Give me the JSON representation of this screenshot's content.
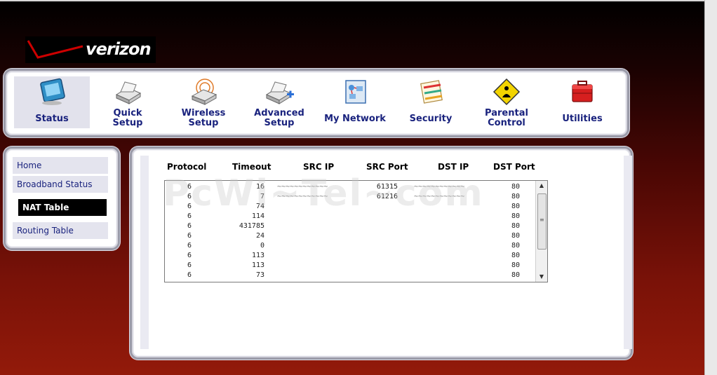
{
  "brand": {
    "logo_text": "verizon",
    "accent_color": "#cc0000"
  },
  "nav": {
    "items": [
      {
        "label_1": "Status",
        "label_2": "",
        "icon": "status-icon",
        "active": true
      },
      {
        "label_1": "Quick",
        "label_2": "Setup",
        "icon": "quick-setup-icon"
      },
      {
        "label_1": "Wireless",
        "label_2": "Setup",
        "icon": "wireless-setup-icon"
      },
      {
        "label_1": "Advanced",
        "label_2": "Setup",
        "icon": "advanced-setup-icon"
      },
      {
        "label_1": "My Network",
        "label_2": "",
        "icon": "my-network-icon"
      },
      {
        "label_1": "Security",
        "label_2": "",
        "icon": "security-icon"
      },
      {
        "label_1": "Parental",
        "label_2": "Control",
        "icon": "parental-control-icon"
      },
      {
        "label_1": "Utilities",
        "label_2": "",
        "icon": "utilities-icon"
      }
    ]
  },
  "sidebar": {
    "items": [
      {
        "label": "Home"
      },
      {
        "label": "Broadband Status"
      },
      {
        "label": "NAT Table",
        "active": true
      },
      {
        "label": "Routing Table"
      }
    ]
  },
  "nat_table": {
    "columns": [
      "Protocol",
      "Timeout",
      "SRC IP",
      "SRC Port",
      "DST IP",
      "DST Port"
    ],
    "rows": [
      {
        "protocol": "6",
        "timeout": "16",
        "src_ip": "~~~~~~~~~~~~",
        "src_port": "61315",
        "dst_ip": "~~~~~~~~~~~~",
        "dst_port": "80"
      },
      {
        "protocol": "6",
        "timeout": "7",
        "src_ip": "~~~~~~~~~~~~",
        "src_port": "61216",
        "dst_ip": "~~~~~~~~~~~~",
        "dst_port": "80"
      },
      {
        "protocol": "6",
        "timeout": "74",
        "src_ip": "",
        "src_port": "",
        "dst_ip": "",
        "dst_port": "80"
      },
      {
        "protocol": "6",
        "timeout": "114",
        "src_ip": "",
        "src_port": "",
        "dst_ip": "",
        "dst_port": "80"
      },
      {
        "protocol": "6",
        "timeout": "431785",
        "src_ip": "",
        "src_port": "",
        "dst_ip": "",
        "dst_port": "80"
      },
      {
        "protocol": "6",
        "timeout": "24",
        "src_ip": "",
        "src_port": "",
        "dst_ip": "",
        "dst_port": "80"
      },
      {
        "protocol": "6",
        "timeout": "0",
        "src_ip": "",
        "src_port": "",
        "dst_ip": "",
        "dst_port": "80"
      },
      {
        "protocol": "6",
        "timeout": "113",
        "src_ip": "",
        "src_port": "",
        "dst_ip": "",
        "dst_port": "80"
      },
      {
        "protocol": "6",
        "timeout": "113",
        "src_ip": "",
        "src_port": "",
        "dst_ip": "",
        "dst_port": "80"
      },
      {
        "protocol": "6",
        "timeout": "73",
        "src_ip": "",
        "src_port": "",
        "dst_ip": "",
        "dst_port": "80"
      }
    ]
  },
  "scrollbar": {
    "up_arrow": "▲",
    "down_arrow": "▼",
    "grip": "≡"
  },
  "watermark": {
    "text": "PcWi~Tel~com"
  }
}
